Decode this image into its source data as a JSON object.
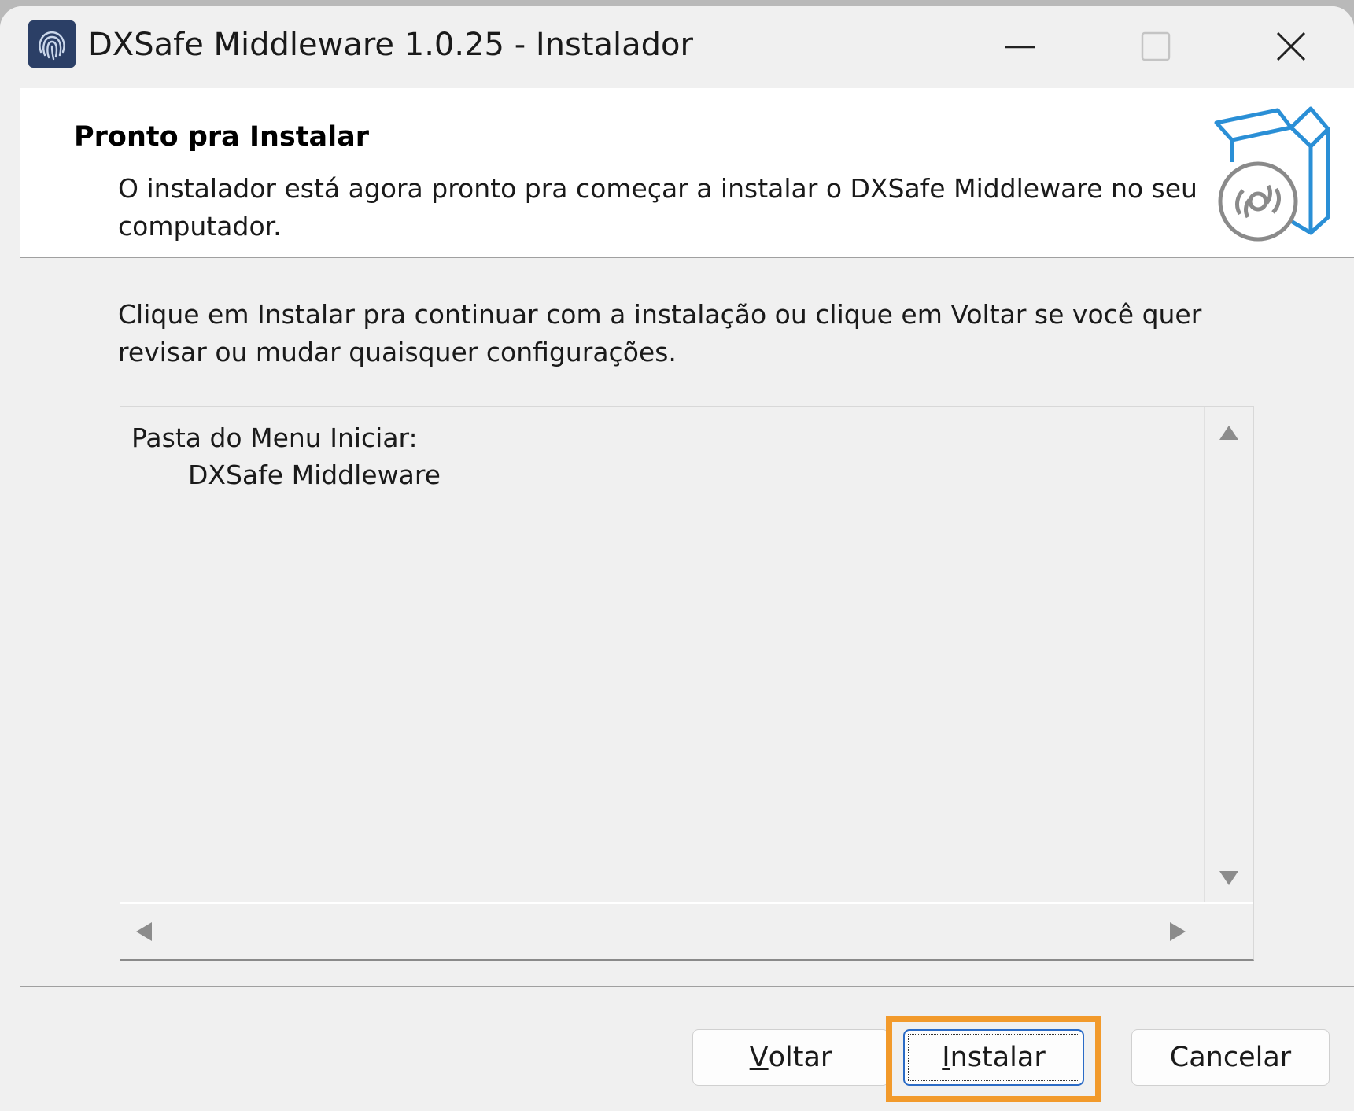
{
  "window": {
    "title": "DXSafe Middleware 1.0.25 - Instalador",
    "icons": [
      "fingerprint-app-icon",
      "minimize-icon",
      "maximize-icon",
      "close-icon"
    ]
  },
  "header": {
    "title": "Pronto pra Instalar",
    "description": "O instalador está agora pronto pra começar a instalar o DXSafe Middleware no seu computador.",
    "graphic": "box-disc-icon"
  },
  "main": {
    "instruction": "Clique em Instalar pra continuar com a instalação ou clique em Voltar se você quer revisar ou mudar quaisquer configurações.",
    "memo": {
      "label": "Pasta do Menu Iniciar:",
      "value": "DXSafe Middleware"
    }
  },
  "buttons": {
    "back": {
      "accel": "V",
      "rest": "oltar"
    },
    "install": {
      "accel": "I",
      "rest": "nstalar"
    },
    "cancel": "Cancelar"
  },
  "colors": {
    "highlight": "#f29a2b",
    "focus_border": "#2b6bc6",
    "graphic_blue": "#2a8fd6"
  }
}
